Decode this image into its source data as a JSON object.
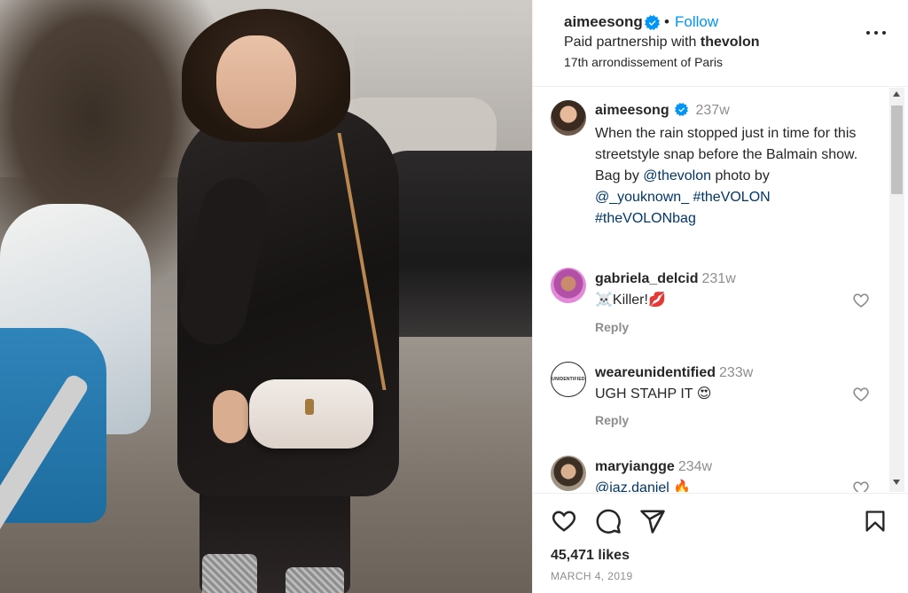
{
  "header": {
    "username": "aimeesong",
    "follow_label": "Follow",
    "separator": "•",
    "partnership_prefix": "Paid partnership with",
    "partner": "thevolon",
    "location": "17th arrondissement of Paris"
  },
  "caption": {
    "username": "aimeesong",
    "time": "237w",
    "text_1": "When the rain stopped just in time for this streetstyle snap before the Balmain show. Bag by ",
    "mention_1": "@thevolon",
    "text_2": " photo by ",
    "mention_2": "@_youknown_",
    "hashtag_1": "#theVOLON",
    "hashtag_2": "#theVOLONbag"
  },
  "comments": [
    {
      "username": "gabriela_delcid",
      "time": "231w",
      "text": "Killer!",
      "emoji_prefix": "☠️",
      "emoji_suffix": "💋",
      "reply_label": "Reply"
    },
    {
      "username": "weareunidentified",
      "time": "233w",
      "text": "UGH STAHP IT",
      "emoji_suffix": "😍",
      "reply_label": "Reply",
      "avatar_text": "UNIDENTIFIED"
    },
    {
      "username": "maryiangge",
      "time": "234w",
      "mention": "@jaz.daniel",
      "emoji_suffix": "🔥"
    }
  ],
  "footer": {
    "likes": "45,471 likes",
    "date": "MARCH 4, 2019"
  },
  "colors": {
    "accent": "#0095f6",
    "link": "#00376b",
    "verified": "#0095f6",
    "muted": "#8e8e8e"
  },
  "icons": [
    "verified-badge-icon",
    "more-options-icon",
    "heart-icon",
    "comment-icon",
    "share-icon",
    "bookmark-icon"
  ]
}
